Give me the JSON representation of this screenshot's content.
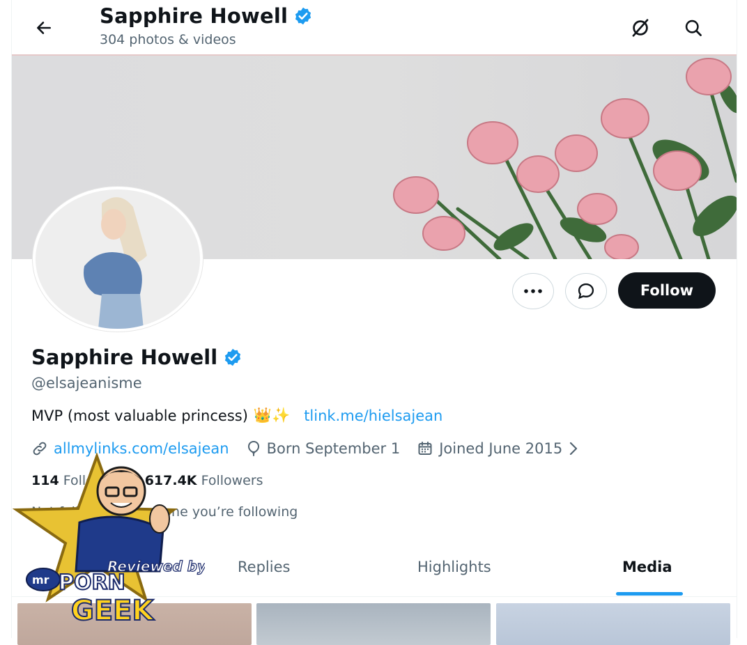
{
  "header": {
    "name": "Sapphire Howell",
    "media_count": "304 photos & videos"
  },
  "profile": {
    "name": "Sapphire Howell",
    "handle": "@elsajeanisme",
    "bio_text": "MVP (most valuable princess)",
    "bio_emoji": "👑✨",
    "bio_link": "tlink.me/hielsajean",
    "website": "allmylinks.com/elsajean",
    "born": "Born September 1",
    "joined": "Joined June 2015",
    "following_count": "114",
    "following_label": "Following",
    "followers_count": "617.4K",
    "followers_label": "Followers",
    "followed_by_text": "Not followed by anyone you’re following",
    "follow_label": "Follow"
  },
  "tabs": [
    {
      "label": "Posts"
    },
    {
      "label": "Replies"
    },
    {
      "label": "Highlights"
    },
    {
      "label": "Media"
    }
  ],
  "colors": {
    "accent": "#1d9bf0",
    "text_primary": "#0f1419",
    "text_secondary": "#536471"
  },
  "watermark": {
    "line1": "Reviewed by",
    "line2": "mr",
    "line3": "PORN",
    "line4": "GEEK"
  }
}
